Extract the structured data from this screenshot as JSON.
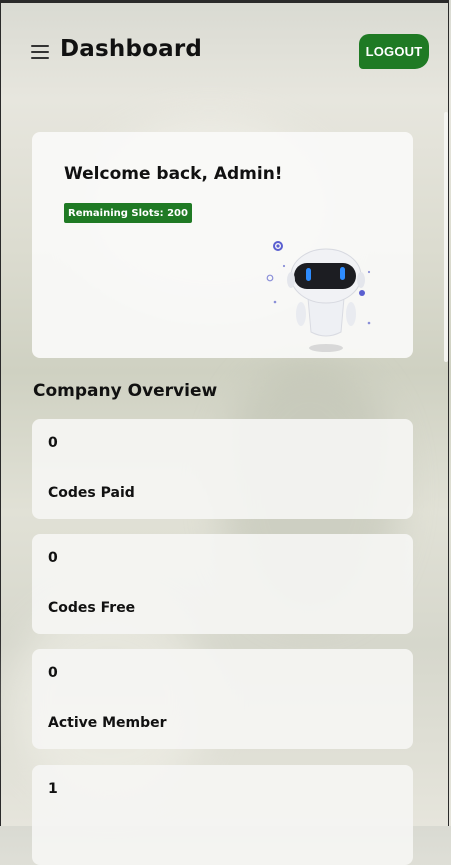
{
  "header": {
    "title": "Dashboard",
    "logout_label": "LOGOUT",
    "menu_icon": "hamburger-menu-icon"
  },
  "welcome": {
    "title": "Welcome back, Admin!",
    "badge": "Remaining Slots: 200",
    "illustration": "robot-illustration"
  },
  "overview": {
    "title": "Company Overview",
    "stats": [
      {
        "value": "0",
        "label": "Codes Paid"
      },
      {
        "value": "0",
        "label": "Codes Free"
      },
      {
        "value": "0",
        "label": "Active Member"
      },
      {
        "value": "1",
        "label": ""
      }
    ]
  },
  "colors": {
    "accent_green": "#1f7a24",
    "card_bg": "#f8f8f6",
    "text": "#111111"
  }
}
